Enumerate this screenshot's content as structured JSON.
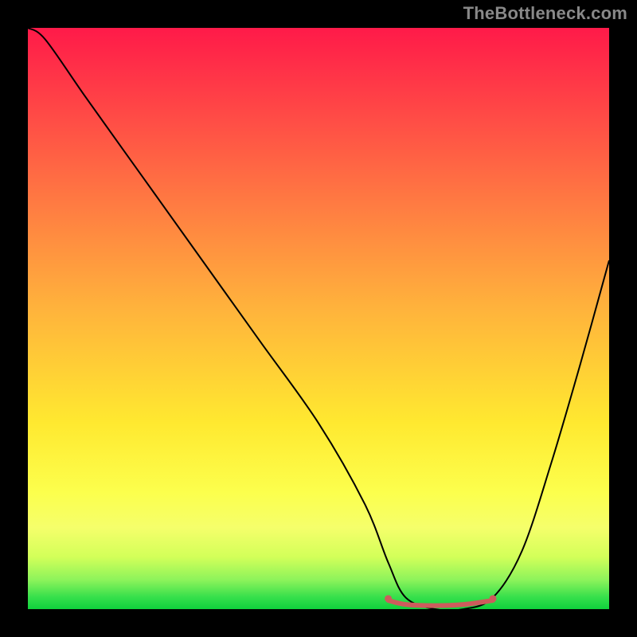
{
  "watermark": "TheBottleneck.com",
  "chart_data": {
    "type": "line",
    "title": "",
    "xlabel": "",
    "ylabel": "",
    "xlim": [
      0,
      100
    ],
    "ylim": [
      0,
      100
    ],
    "grid": false,
    "series": [
      {
        "name": "curve",
        "stroke": "#000000",
        "stroke_width": 2,
        "x": [
          0,
          3,
          10,
          20,
          30,
          40,
          50,
          58,
          62,
          65,
          70,
          75,
          80,
          85,
          90,
          95,
          100
        ],
        "y": [
          100,
          98,
          88,
          74,
          60,
          46,
          32,
          18,
          8,
          2,
          0,
          0,
          2,
          10,
          25,
          42,
          60
        ]
      },
      {
        "name": "highlight-band",
        "stroke": "#cd5c5c",
        "stroke_width": 6,
        "x": [
          62,
          65,
          70,
          75,
          80
        ],
        "y": [
          1.5,
          0.8,
          0.6,
          0.8,
          1.5
        ]
      }
    ],
    "highlight_endpoints": {
      "color": "#cd5c5c",
      "radius": 4.5,
      "points": [
        {
          "x": 62,
          "y": 1.8
        },
        {
          "x": 80,
          "y": 1.8
        }
      ]
    }
  }
}
